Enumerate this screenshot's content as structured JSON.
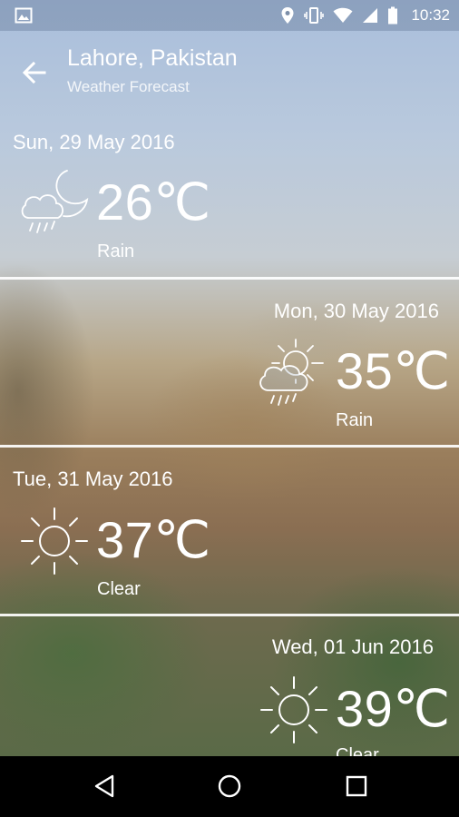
{
  "status_bar": {
    "time": "10:32",
    "icons": [
      "image-icon",
      "location-icon",
      "vibrate-icon",
      "wifi-icon",
      "signal-icon",
      "battery-icon"
    ]
  },
  "header": {
    "title": "Lahore, Pakistan",
    "subtitle": "Weather Forecast",
    "back_icon": "arrow-back-icon"
  },
  "forecast": [
    {
      "date": "Sun, 29 May 2016",
      "temp": "26℃",
      "condition": "Rain",
      "icon": "moon-cloud-rain-icon"
    },
    {
      "date": "Mon, 30 May 2016",
      "temp": "35℃",
      "condition": "Rain",
      "icon": "sun-cloud-rain-icon"
    },
    {
      "date": "Tue, 31 May 2016",
      "temp": "37℃",
      "condition": "Clear",
      "icon": "sun-icon"
    },
    {
      "date": "Wed, 01 Jun 2016",
      "temp": "39℃",
      "condition": "Clear",
      "icon": "sun-icon"
    }
  ],
  "nav_bar": {
    "buttons": [
      "back-triangle-icon",
      "home-circle-icon",
      "recents-square-icon"
    ]
  }
}
